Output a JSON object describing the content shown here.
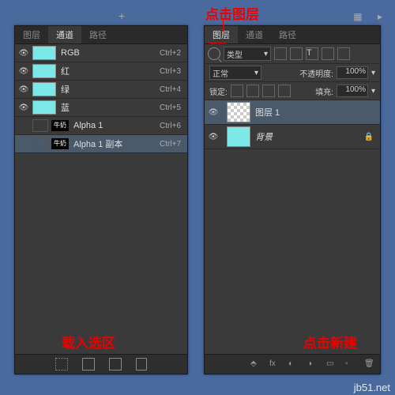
{
  "annotations": {
    "click_layer": "点击图层",
    "load_selection": "载入选区",
    "click_new": "点击新建"
  },
  "top_icons": {
    "plus": "+"
  },
  "left_panel": {
    "tabs": [
      "图层",
      "通道",
      "路径"
    ],
    "active_tab": 1,
    "channels": [
      {
        "name": "RGB",
        "color": "#7ce8e8",
        "shortcut": "Ctrl+2",
        "eye": true
      },
      {
        "name": "红",
        "color": "#7ce8e8",
        "shortcut": "Ctrl+3",
        "eye": true
      },
      {
        "name": "绿",
        "color": "#7ce8e8",
        "shortcut": "Ctrl+4",
        "eye": true
      },
      {
        "name": "蓝",
        "color": "#7ce8e8",
        "shortcut": "Ctrl+5",
        "eye": true
      },
      {
        "name": "Alpha 1",
        "bw": "牛奶",
        "shortcut": "Ctrl+6",
        "eye": false
      },
      {
        "name": "Alpha 1 副本",
        "bw": "牛奶",
        "shortcut": "Ctrl+7",
        "eye": false,
        "selected": true
      }
    ]
  },
  "right_panel": {
    "tabs": [
      "图层",
      "通道",
      "路径"
    ],
    "active_tab": 0,
    "filter_label": "类型",
    "blend_mode": "正常",
    "opacity_label": "不透明度:",
    "opacity_value": "100%",
    "lock_label": "锁定:",
    "fill_label": "填充:",
    "fill_value": "100%",
    "layers": [
      {
        "name": "图层 1",
        "thumb": "checker",
        "selected": true
      },
      {
        "name": "背景",
        "thumb": "cyan",
        "italic": true,
        "locked": true
      }
    ]
  },
  "watermark": "jb51.net"
}
